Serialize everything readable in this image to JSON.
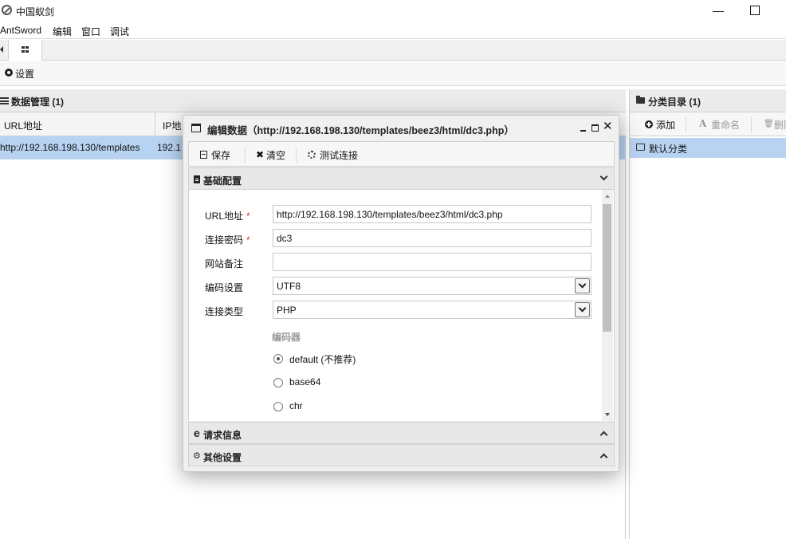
{
  "window": {
    "title": "中国蚁剑",
    "minimize_glyph": "—"
  },
  "menubar": {
    "items": [
      "AntSword",
      "编辑",
      "窗口",
      "调试"
    ]
  },
  "toolbar": {
    "settings_label": "设置"
  },
  "data_panel": {
    "title": "数据管理 (1)",
    "columns": [
      "URL地址",
      "IP地"
    ],
    "rows": [
      {
        "url": "http://192.168.198.130/templates",
        "ip": "192.1"
      }
    ]
  },
  "category_panel": {
    "title": "分类目录 (1)",
    "add_label": "添加",
    "rename_label": "重命名",
    "delete_label": "删除",
    "rename_glyph": "A",
    "delete_glyph": "🗑",
    "tree_items": [
      "默认分类"
    ]
  },
  "dialog": {
    "title": "编辑数据（http://192.168.198.130/templates/beez3/html/dc3.php）",
    "close_glyph": "✕",
    "toolbar": {
      "save_label": "保存",
      "clear_label": "清空",
      "clear_glyph": "✖",
      "test_label": "测试连接"
    },
    "sections": {
      "basic": "基础配置",
      "request": "请求信息",
      "request_glyph": "e",
      "other": "其他设置",
      "other_glyph": "⚙"
    },
    "form": {
      "url_label": "URL地址",
      "url_value": "http://192.168.198.130/templates/beez3/html/dc3.php",
      "password_label": "连接密码",
      "password_value": "dc3",
      "note_label": "网站备注",
      "note_value": "",
      "encoding_label": "编码设置",
      "encoding_value": "UTF8",
      "type_label": "连接类型",
      "type_value": "PHP",
      "required_mark": "*",
      "encoder_label": "编码器",
      "encoders": [
        {
          "label": "default (不推荐)",
          "selected": true
        },
        {
          "label": "base64",
          "selected": false
        },
        {
          "label": "chr",
          "selected": false
        }
      ]
    }
  }
}
